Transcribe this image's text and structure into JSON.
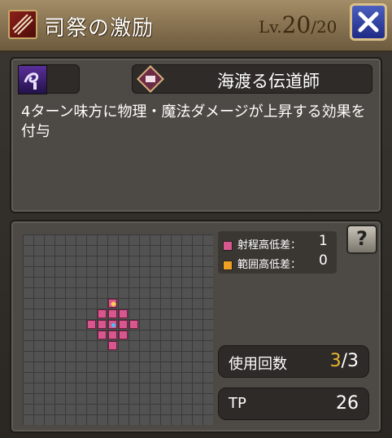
{
  "header": {
    "title": "司祭の激励",
    "lv_prefix": "Lv.",
    "lv_current": "20",
    "lv_max": "/20",
    "close_icon": "close-x-icon",
    "skill_icon": "claw-slash-icon"
  },
  "info": {
    "job_icon": "wind-swirl-icon",
    "category_icon": "scroll-badge-icon",
    "category_name": "海渡る伝道師",
    "description": "4ターン味方に物理・魔法ダメージが上昇する効果を付与"
  },
  "legend": {
    "range_label": "射程高低差：",
    "range_value": "1",
    "area_label": "範囲高低差：",
    "area_value": "0",
    "range_color": "#d9578f",
    "area_color": "#f0a020"
  },
  "stats": {
    "uses_label": "使用回数",
    "uses_current": "3",
    "uses_max": "/3",
    "tp_label": "TP",
    "tp_value": "26"
  },
  "help_icon": "help-question-icon"
}
